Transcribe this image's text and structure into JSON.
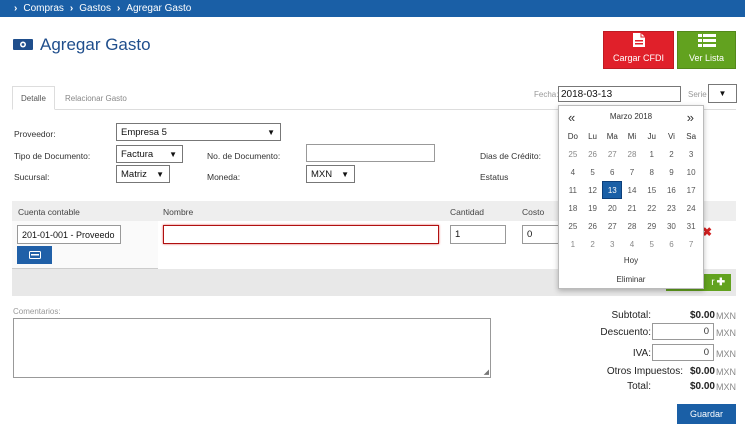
{
  "breadcrumb": {
    "items": [
      "Compras",
      "Gastos",
      "Agregar Gasto"
    ]
  },
  "page": {
    "title": "Agregar Gasto"
  },
  "actions": {
    "cargar_cfdi": "Cargar CFDI",
    "ver_lista": "Ver Lista"
  },
  "tabs": [
    {
      "label": "Detalle"
    },
    {
      "label": "Relacionar Gasto"
    }
  ],
  "header_fields": {
    "fecha_label": "Fecha:",
    "fecha_value": "2018-03-13",
    "serie_label": "Serie"
  },
  "form": {
    "proveedor_label": "Proveedor:",
    "proveedor_value": "Empresa 5",
    "tipo_doc_label": "Tipo de Documento:",
    "tipo_doc_value": "Factura",
    "no_doc_label": "No. de Documento:",
    "no_doc_value": "",
    "dias_credito_label": "Dias de Crédito:",
    "sucursal_label": "Sucursal:",
    "sucursal_value": "Matriz",
    "moneda_label": "Moneda:",
    "moneda_value": "MXN",
    "estatus_label": "Estatus"
  },
  "table": {
    "headers": [
      "Cuenta contable",
      "Nombre",
      "Cantidad",
      "Costo"
    ],
    "row": {
      "cuenta": "201-01-001 - Proveedo",
      "nombre": "",
      "cantidad": "1",
      "costo": "0"
    },
    "delete_glyph": "✖",
    "add_suffix": "r"
  },
  "comments": {
    "label": "Comentarios:"
  },
  "totals": {
    "subtotal_label": "Subtotal:",
    "subtotal_value": "$0.00",
    "descuento_label": "Descuento:",
    "descuento_value": "0",
    "iva_label": "IVA:",
    "iva_value": "0",
    "otros_label": "Otros Impuestos:",
    "otros_value": "$0.00",
    "total_label": "Total:",
    "total_value": "$0.00",
    "currency": "MXN"
  },
  "save_button": "Guardar",
  "calendar": {
    "prev": "«",
    "next": "»",
    "title": "Marzo 2018",
    "weekdays": [
      "Do",
      "Lu",
      "Ma",
      "Mi",
      "Ju",
      "Vi",
      "Sa"
    ],
    "weeks": [
      [
        "25",
        "26",
        "27",
        "28",
        "1",
        "2",
        "3"
      ],
      [
        "4",
        "5",
        "6",
        "7",
        "8",
        "9",
        "10"
      ],
      [
        "11",
        "12",
        "13",
        "14",
        "15",
        "16",
        "17"
      ],
      [
        "18",
        "19",
        "20",
        "21",
        "22",
        "23",
        "24"
      ],
      [
        "25",
        "26",
        "27",
        "28",
        "29",
        "30",
        "31"
      ],
      [
        "1",
        "2",
        "3",
        "4",
        "5",
        "6",
        "7"
      ]
    ],
    "selected": "13",
    "today_label": "Hoy",
    "clear_label": "Eliminar"
  },
  "colors": {
    "brand_blue": "#1a5fa6",
    "red": "#e0202a",
    "green": "#62a21f"
  },
  "icons": [
    "chevron-right-icon",
    "cash-icon",
    "pdf-icon",
    "list-icon",
    "caret-down-icon",
    "close-icon",
    "plus-icon"
  ]
}
